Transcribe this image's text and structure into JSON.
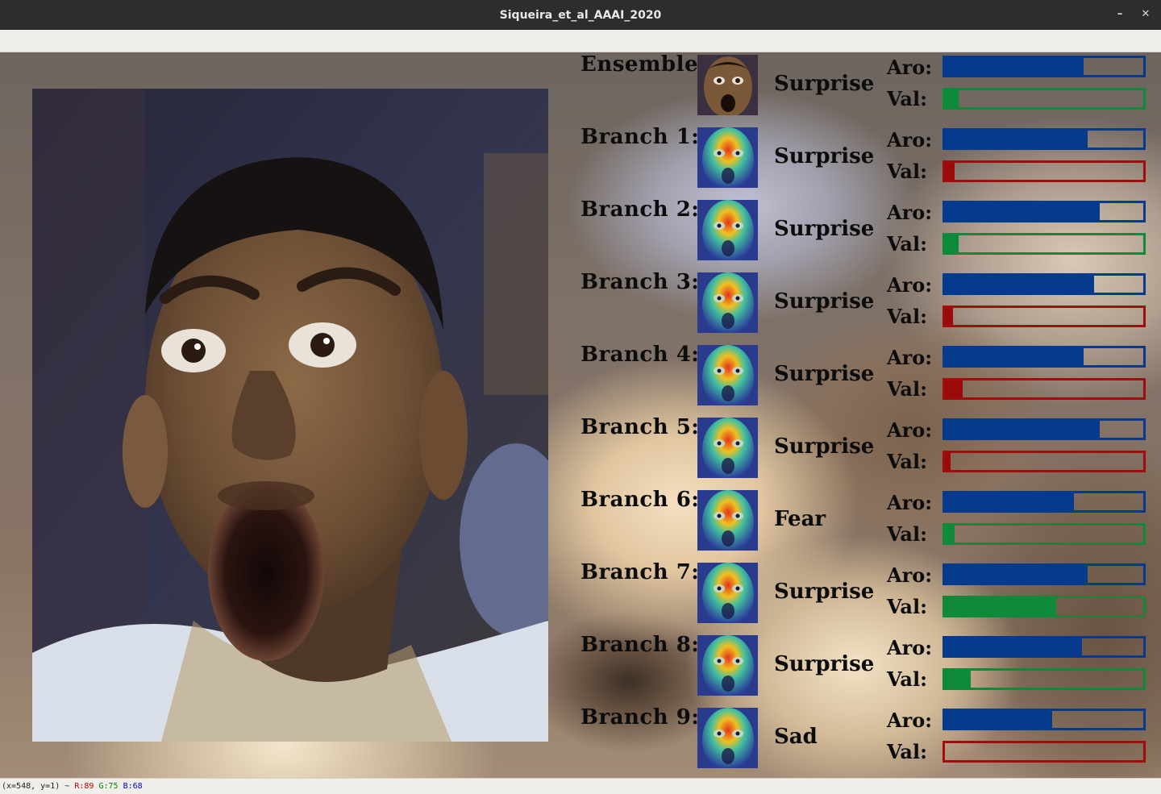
{
  "window": {
    "title": "Siqueira_et_al_AAAI_2020"
  },
  "status": {
    "coords": "(x=548, y=1) ~",
    "r": "R:89",
    "g": "G:75",
    "b": "B:68"
  },
  "labels": {
    "aro": "Aro:",
    "val": "Val:"
  },
  "colors": {
    "arousal": "#063a8c",
    "valence_positive": "#0f8a3a",
    "valence_negative": "#9a0a0a"
  },
  "predictions": [
    {
      "name": "Ensemble:",
      "thumbnail": "face-plain",
      "emotion": "Surprise",
      "arousal": 0.7,
      "valence": 0.07,
      "valence_sign": "positive"
    },
    {
      "name": "Branch 1:",
      "thumbnail": "face-heatmap",
      "emotion": "Surprise",
      "arousal": 0.72,
      "valence": 0.05,
      "valence_sign": "negative"
    },
    {
      "name": "Branch 2:",
      "thumbnail": "face-heatmap",
      "emotion": "Surprise",
      "arousal": 0.78,
      "valence": 0.07,
      "valence_sign": "positive"
    },
    {
      "name": "Branch 3:",
      "thumbnail": "face-heatmap",
      "emotion": "Surprise",
      "arousal": 0.75,
      "valence": 0.04,
      "valence_sign": "negative"
    },
    {
      "name": "Branch 4:",
      "thumbnail": "face-heatmap",
      "emotion": "Surprise",
      "arousal": 0.7,
      "valence": 0.09,
      "valence_sign": "negative"
    },
    {
      "name": "Branch 5:",
      "thumbnail": "face-heatmap",
      "emotion": "Surprise",
      "arousal": 0.78,
      "valence": 0.03,
      "valence_sign": "negative"
    },
    {
      "name": "Branch 6:",
      "thumbnail": "face-heatmap",
      "emotion": "Fear",
      "arousal": 0.65,
      "valence": 0.05,
      "valence_sign": "positive"
    },
    {
      "name": "Branch 7:",
      "thumbnail": "face-heatmap",
      "emotion": "Surprise",
      "arousal": 0.72,
      "valence": 0.56,
      "valence_sign": "positive"
    },
    {
      "name": "Branch 8:",
      "thumbnail": "face-heatmap",
      "emotion": "Surprise",
      "arousal": 0.69,
      "valence": 0.13,
      "valence_sign": "positive"
    },
    {
      "name": "Branch 9:",
      "thumbnail": "face-heatmap",
      "emotion": "Sad",
      "arousal": 0.54,
      "valence": 0.0,
      "valence_sign": "negative"
    }
  ]
}
